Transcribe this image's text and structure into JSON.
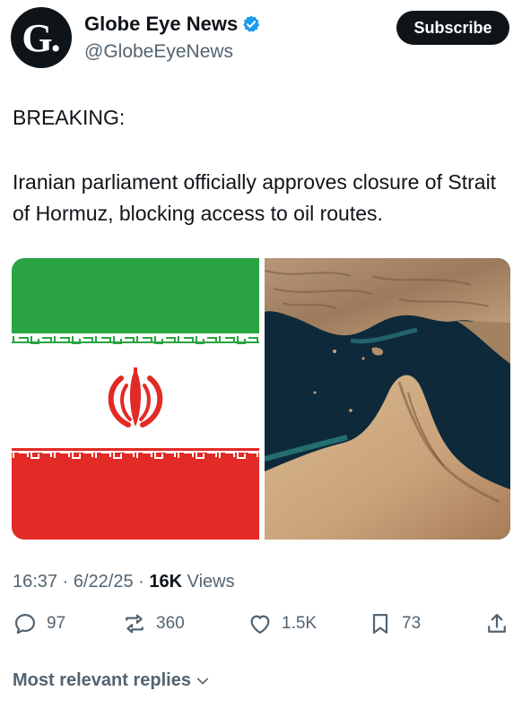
{
  "account": {
    "avatar_letter": "G",
    "name": "Globe Eye News",
    "handle": "@GlobeEyeNews",
    "verified_color": "#1d9bf0",
    "subscribe_label": "Subscribe"
  },
  "post": {
    "heading": "BREAKING:",
    "text": "Iranian parliament officially approves closure of Strait of Hormuz, blocking access to oil routes.",
    "time": "16:37",
    "date": "6/22/25",
    "views_count": "16K",
    "views_label": "Views"
  },
  "media": {
    "left_icon": "iran-flag-image",
    "right_icon": "strait-of-hormuz-satellite-image"
  },
  "actions": {
    "replies": "97",
    "reposts": "360",
    "likes": "1.5K",
    "bookmarks": "73"
  },
  "footer": {
    "replies_sort_label": "Most relevant replies"
  },
  "colors": {
    "text": "#0f1419",
    "muted": "#536471",
    "flag_green": "#2aa442",
    "flag_red": "#e22a26"
  }
}
